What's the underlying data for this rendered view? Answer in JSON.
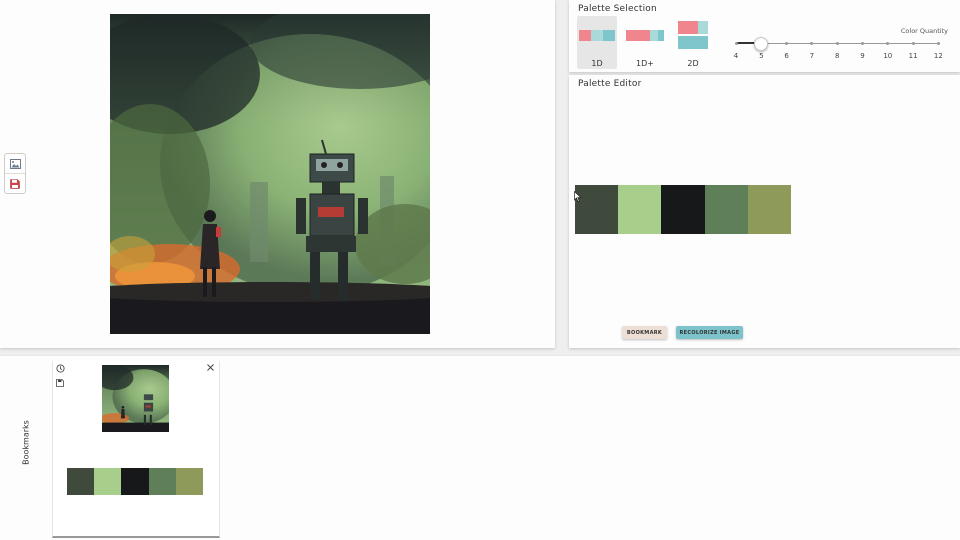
{
  "image_panel": {
    "tools": [
      {
        "name": "image-icon"
      },
      {
        "name": "save-icon"
      }
    ]
  },
  "palette_selection": {
    "title": "Palette Selection",
    "types": [
      {
        "label": "1D",
        "selected": true
      },
      {
        "label": "1D+",
        "selected": false
      },
      {
        "label": "2D",
        "selected": false
      }
    ],
    "quantity": {
      "label": "Color Quantity",
      "ticks": [
        "4",
        "5",
        "6",
        "7",
        "8",
        "9",
        "10",
        "11",
        "12"
      ],
      "value": 5
    }
  },
  "palette_editor": {
    "title": "Palette Editor",
    "colors": [
      "#3f4a3d",
      "#a8ce8c",
      "#16181a",
      "#5e7f58",
      "#8e9a5a"
    ],
    "bookmark_label": "BOOKMARK",
    "recolorize_label": "RECOLORIZE IMAGE"
  },
  "bookmarks": {
    "label": "Bookmarks",
    "items": [
      {
        "colors": [
          "#3f4a3d",
          "#a8ce8c",
          "#16181a",
          "#5e7f58",
          "#8e9a5a"
        ]
      }
    ]
  },
  "theme": {
    "bookmark_button": "#eedfd6",
    "recolorize_button": "#7cc3cc",
    "preview_pink": "#f0858e",
    "preview_teal": "#7fc6cc"
  }
}
